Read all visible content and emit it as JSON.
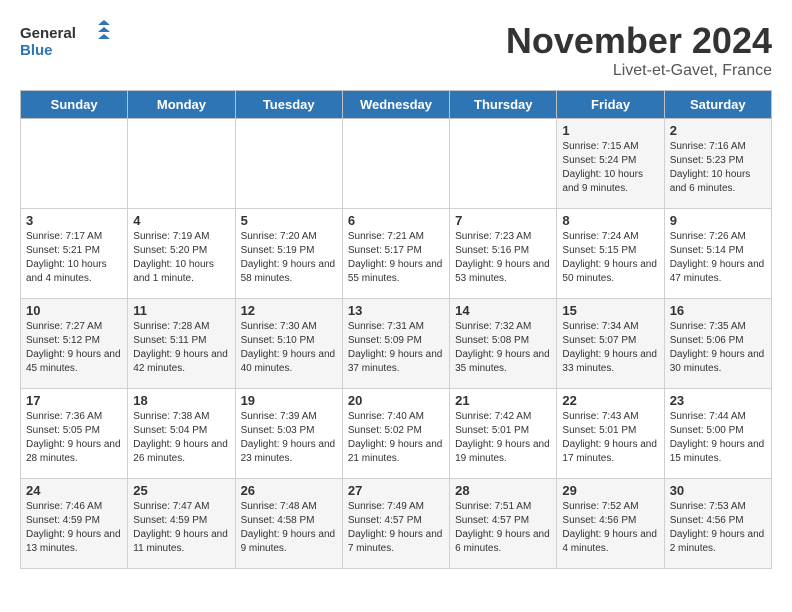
{
  "header": {
    "logo_general": "General",
    "logo_blue": "Blue",
    "month_title": "November 2024",
    "subtitle": "Livet-et-Gavet, France"
  },
  "weekdays": [
    "Sunday",
    "Monday",
    "Tuesday",
    "Wednesday",
    "Thursday",
    "Friday",
    "Saturday"
  ],
  "weeks": [
    [
      {
        "day": "",
        "info": ""
      },
      {
        "day": "",
        "info": ""
      },
      {
        "day": "",
        "info": ""
      },
      {
        "day": "",
        "info": ""
      },
      {
        "day": "",
        "info": ""
      },
      {
        "day": "1",
        "info": "Sunrise: 7:15 AM\nSunset: 5:24 PM\nDaylight: 10 hours and 9 minutes."
      },
      {
        "day": "2",
        "info": "Sunrise: 7:16 AM\nSunset: 5:23 PM\nDaylight: 10 hours and 6 minutes."
      }
    ],
    [
      {
        "day": "3",
        "info": "Sunrise: 7:17 AM\nSunset: 5:21 PM\nDaylight: 10 hours and 4 minutes."
      },
      {
        "day": "4",
        "info": "Sunrise: 7:19 AM\nSunset: 5:20 PM\nDaylight: 10 hours and 1 minute."
      },
      {
        "day": "5",
        "info": "Sunrise: 7:20 AM\nSunset: 5:19 PM\nDaylight: 9 hours and 58 minutes."
      },
      {
        "day": "6",
        "info": "Sunrise: 7:21 AM\nSunset: 5:17 PM\nDaylight: 9 hours and 55 minutes."
      },
      {
        "day": "7",
        "info": "Sunrise: 7:23 AM\nSunset: 5:16 PM\nDaylight: 9 hours and 53 minutes."
      },
      {
        "day": "8",
        "info": "Sunrise: 7:24 AM\nSunset: 5:15 PM\nDaylight: 9 hours and 50 minutes."
      },
      {
        "day": "9",
        "info": "Sunrise: 7:26 AM\nSunset: 5:14 PM\nDaylight: 9 hours and 47 minutes."
      }
    ],
    [
      {
        "day": "10",
        "info": "Sunrise: 7:27 AM\nSunset: 5:12 PM\nDaylight: 9 hours and 45 minutes."
      },
      {
        "day": "11",
        "info": "Sunrise: 7:28 AM\nSunset: 5:11 PM\nDaylight: 9 hours and 42 minutes."
      },
      {
        "day": "12",
        "info": "Sunrise: 7:30 AM\nSunset: 5:10 PM\nDaylight: 9 hours and 40 minutes."
      },
      {
        "day": "13",
        "info": "Sunrise: 7:31 AM\nSunset: 5:09 PM\nDaylight: 9 hours and 37 minutes."
      },
      {
        "day": "14",
        "info": "Sunrise: 7:32 AM\nSunset: 5:08 PM\nDaylight: 9 hours and 35 minutes."
      },
      {
        "day": "15",
        "info": "Sunrise: 7:34 AM\nSunset: 5:07 PM\nDaylight: 9 hours and 33 minutes."
      },
      {
        "day": "16",
        "info": "Sunrise: 7:35 AM\nSunset: 5:06 PM\nDaylight: 9 hours and 30 minutes."
      }
    ],
    [
      {
        "day": "17",
        "info": "Sunrise: 7:36 AM\nSunset: 5:05 PM\nDaylight: 9 hours and 28 minutes."
      },
      {
        "day": "18",
        "info": "Sunrise: 7:38 AM\nSunset: 5:04 PM\nDaylight: 9 hours and 26 minutes."
      },
      {
        "day": "19",
        "info": "Sunrise: 7:39 AM\nSunset: 5:03 PM\nDaylight: 9 hours and 23 minutes."
      },
      {
        "day": "20",
        "info": "Sunrise: 7:40 AM\nSunset: 5:02 PM\nDaylight: 9 hours and 21 minutes."
      },
      {
        "day": "21",
        "info": "Sunrise: 7:42 AM\nSunset: 5:01 PM\nDaylight: 9 hours and 19 minutes."
      },
      {
        "day": "22",
        "info": "Sunrise: 7:43 AM\nSunset: 5:01 PM\nDaylight: 9 hours and 17 minutes."
      },
      {
        "day": "23",
        "info": "Sunrise: 7:44 AM\nSunset: 5:00 PM\nDaylight: 9 hours and 15 minutes."
      }
    ],
    [
      {
        "day": "24",
        "info": "Sunrise: 7:46 AM\nSunset: 4:59 PM\nDaylight: 9 hours and 13 minutes."
      },
      {
        "day": "25",
        "info": "Sunrise: 7:47 AM\nSunset: 4:59 PM\nDaylight: 9 hours and 11 minutes."
      },
      {
        "day": "26",
        "info": "Sunrise: 7:48 AM\nSunset: 4:58 PM\nDaylight: 9 hours and 9 minutes."
      },
      {
        "day": "27",
        "info": "Sunrise: 7:49 AM\nSunset: 4:57 PM\nDaylight: 9 hours and 7 minutes."
      },
      {
        "day": "28",
        "info": "Sunrise: 7:51 AM\nSunset: 4:57 PM\nDaylight: 9 hours and 6 minutes."
      },
      {
        "day": "29",
        "info": "Sunrise: 7:52 AM\nSunset: 4:56 PM\nDaylight: 9 hours and 4 minutes."
      },
      {
        "day": "30",
        "info": "Sunrise: 7:53 AM\nSunset: 4:56 PM\nDaylight: 9 hours and 2 minutes."
      }
    ]
  ]
}
